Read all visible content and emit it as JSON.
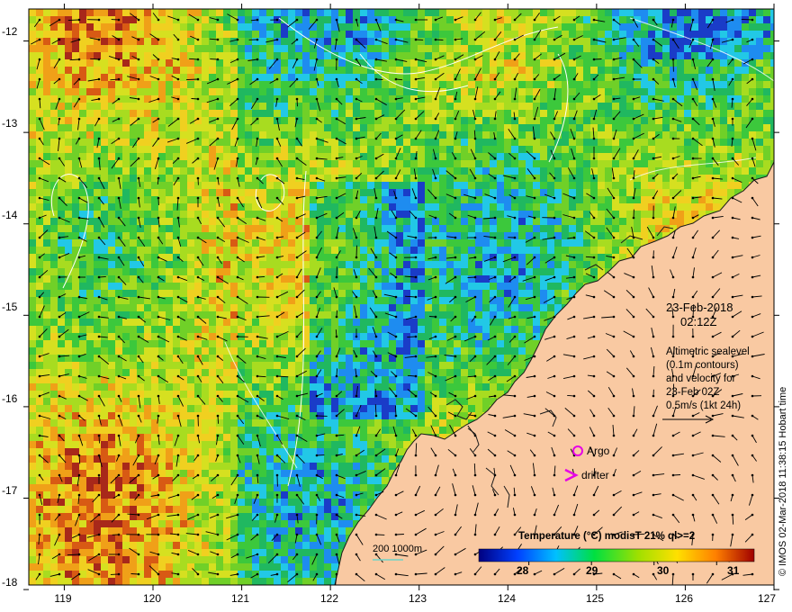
{
  "map": {
    "title_date": "23-Feb-2018",
    "title_time": "02:12Z",
    "legend_lines": [
      "Altimetric sealevel",
      "(0.1m contours)",
      "and velocity for",
      "23-Feb 02Z",
      "0.5m/s (1kt 24h)"
    ],
    "argo_label": "Argo",
    "drifter_label": "drifter",
    "depth_label": "200  1000m",
    "colorbar_title": "Temperature (°C) modisT 21% ql>=2",
    "colorbar_ticks": [
      "28",
      "29",
      "30",
      "31"
    ],
    "colorbar_range": [
      27.2,
      31.6
    ],
    "credit": "© IMOS 02-Mar-2018 11:38:15 Hobart time",
    "lon_ticks": [
      "119",
      "120",
      "121",
      "122",
      "123",
      "124",
      "125",
      "126",
      "127"
    ],
    "lat_ticks": [
      "-12",
      "-13",
      "-14",
      "-15",
      "-16",
      "-17",
      "-18"
    ],
    "lon_range": [
      118.6,
      127.0
    ],
    "lat_range": [
      -17.95,
      -11.65
    ],
    "colors": {
      "land": "#f9c9a2",
      "coast": "#1a1a1a",
      "argo": "#e600e6",
      "drifter": "#e600e6",
      "contour": "#ffffff",
      "depth": "#6fd4c8"
    }
  }
}
